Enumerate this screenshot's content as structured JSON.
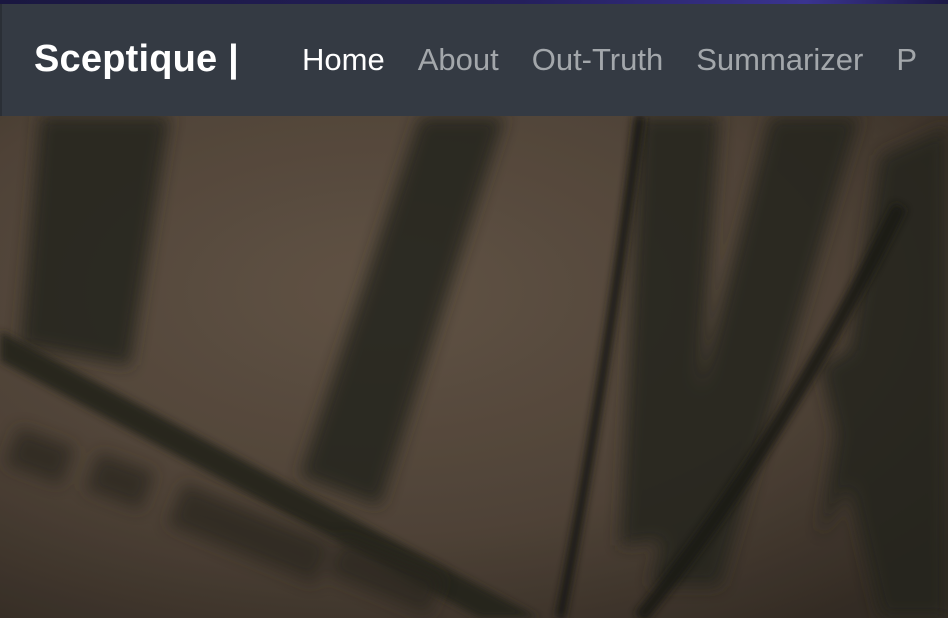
{
  "navbar": {
    "brand": "Sceptique |",
    "links": [
      {
        "label": "Home",
        "active": true
      },
      {
        "label": "About",
        "active": false
      },
      {
        "label": "Out-Truth",
        "active": false
      },
      {
        "label": "Summarizer",
        "active": false
      },
      {
        "label": "P",
        "active": false
      }
    ]
  },
  "colors": {
    "navbar_bg": "#343a43",
    "link_active": "#ffffff",
    "link_inactive": "#a3a7ab",
    "hero_tone": "#5a4d40"
  }
}
